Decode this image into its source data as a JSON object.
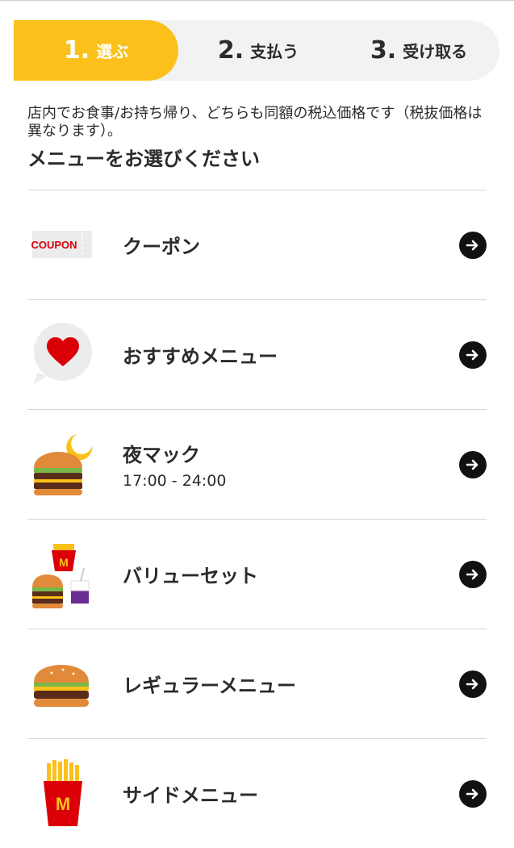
{
  "stepper": {
    "steps": [
      {
        "number": "1.",
        "label": "選ぶ",
        "active": true
      },
      {
        "number": "2.",
        "label": "支払う",
        "active": false
      },
      {
        "number": "3.",
        "label": "受け取る",
        "active": false
      }
    ]
  },
  "intro": {
    "note": "店内でお食事/お持ち帰り、どちらも同額の税込価格です（税抜価格は異なります）。",
    "title": "メニューをお選びください"
  },
  "menu": {
    "items": [
      {
        "label": "クーポン",
        "icon": "coupon-icon",
        "coupon_text": "COUPON"
      },
      {
        "label": "おすすめメニュー",
        "icon": "heart-bubble-icon"
      },
      {
        "label": "夜マック",
        "sub": "17:00 - 24:00",
        "icon": "burger-moon-icon"
      },
      {
        "label": "バリューセット",
        "icon": "value-set-icon"
      },
      {
        "label": "レギュラーメニュー",
        "icon": "burger-icon"
      },
      {
        "label": "サイドメニュー",
        "icon": "fries-icon"
      }
    ]
  },
  "colors": {
    "accent": "#fbc11a",
    "brand_red": "#db0007",
    "text": "#2b2b2b",
    "arrow": "#111111"
  }
}
